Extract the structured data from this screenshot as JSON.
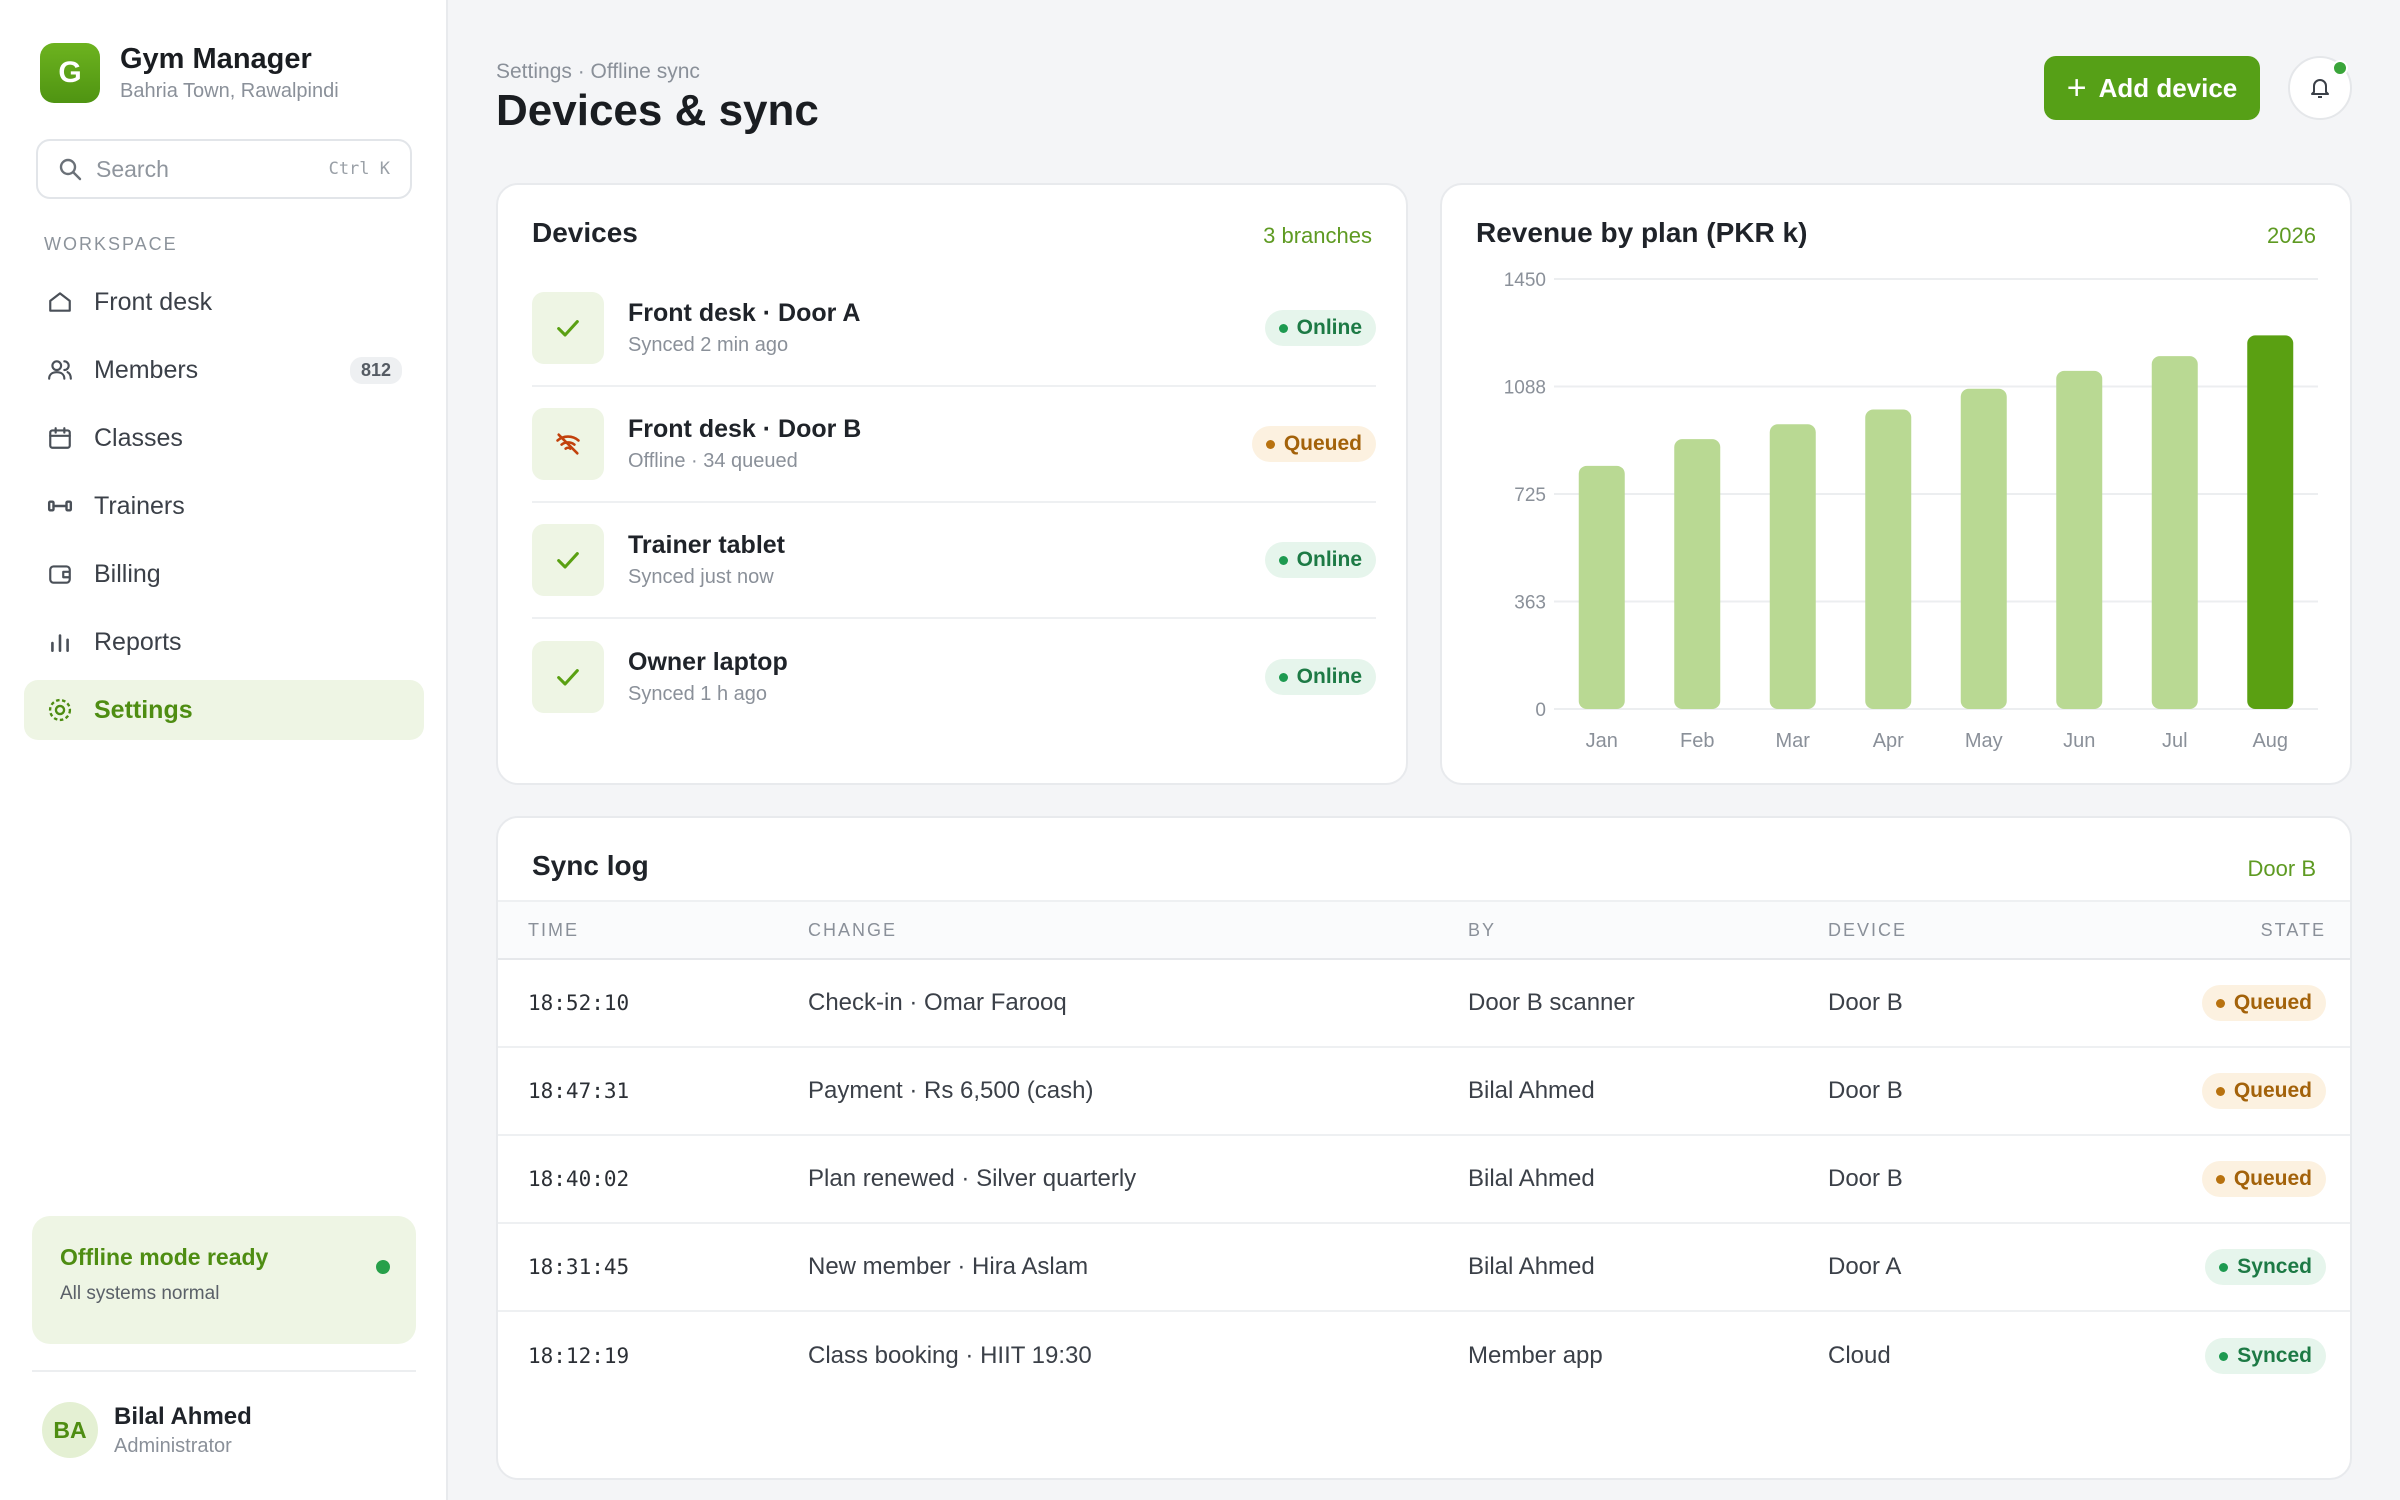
{
  "brand": {
    "initial": "G",
    "name": "Gym Manager",
    "location": "Bahria Town, Rawalpindi"
  },
  "search": {
    "placeholder": "Search",
    "shortcut": "Ctrl K"
  },
  "sidebar": {
    "section_label": "WORKSPACE",
    "items": [
      {
        "label": "Front desk",
        "icon": "home-icon"
      },
      {
        "label": "Members",
        "icon": "users-icon",
        "count": "812"
      },
      {
        "label": "Classes",
        "icon": "calendar-icon"
      },
      {
        "label": "Trainers",
        "icon": "dumbbell-icon"
      },
      {
        "label": "Billing",
        "icon": "wallet-icon"
      },
      {
        "label": "Reports",
        "icon": "bar-chart-icon"
      },
      {
        "label": "Settings",
        "icon": "gear-icon",
        "active": true
      }
    ],
    "offline": {
      "title": "Offline mode ready",
      "subtitle": "All systems normal"
    },
    "user": {
      "initials": "BA",
      "name": "Bilal Ahmed",
      "role": "Administrator"
    }
  },
  "header": {
    "breadcrumb": "Settings · Offline sync",
    "title": "Devices & sync",
    "add_label": "Add device"
  },
  "devices": {
    "title": "Devices",
    "meta": "3 branches",
    "items": [
      {
        "name": "Front desk · Door A",
        "sub": "Synced 2 min ago",
        "status": "Online",
        "state": "online",
        "icon": "check-icon"
      },
      {
        "name": "Front desk · Door B",
        "sub": "Offline · 34 queued",
        "status": "Queued",
        "state": "queued",
        "icon": "wifi-off-icon"
      },
      {
        "name": "Trainer tablet",
        "sub": "Synced just now",
        "status": "Online",
        "state": "online",
        "icon": "check-icon"
      },
      {
        "name": "Owner laptop",
        "sub": "Synced 1 h ago",
        "status": "Online",
        "state": "online",
        "icon": "check-icon"
      }
    ]
  },
  "chart_data": {
    "type": "bar",
    "title": "Revenue by plan (PKR k)",
    "meta": "2026",
    "categories": [
      "Jan",
      "Feb",
      "Mar",
      "Apr",
      "May",
      "Jun",
      "Jul",
      "Aug"
    ],
    "values": [
      820,
      910,
      960,
      1010,
      1080,
      1140,
      1190,
      1260
    ],
    "highlight_index": 7,
    "ylim": [
      0,
      1450
    ],
    "yticks": [
      "0",
      "363",
      "725",
      "1088",
      "1450"
    ],
    "colors": {
      "bar": "#b9d993",
      "highlight": "#5aa012",
      "grid": "#eceef0"
    }
  },
  "sync_log": {
    "title": "Sync log",
    "meta": "Door B",
    "columns": [
      "TIME",
      "CHANGE",
      "BY",
      "DEVICE",
      "STATE"
    ],
    "rows": [
      {
        "time": "18:52:10",
        "change": "Check-in · Omar Farooq",
        "by": "Door B scanner",
        "device": "Door B",
        "state": "Queued",
        "kind": "queued"
      },
      {
        "time": "18:47:31",
        "change": "Payment · Rs 6,500 (cash)",
        "by": "Bilal Ahmed",
        "device": "Door B",
        "state": "Queued",
        "kind": "queued"
      },
      {
        "time": "18:40:02",
        "change": "Plan renewed · Silver quarterly",
        "by": "Bilal Ahmed",
        "device": "Door B",
        "state": "Queued",
        "kind": "queued"
      },
      {
        "time": "18:31:45",
        "change": "New member · Hira Aslam",
        "by": "Bilal Ahmed",
        "device": "Door A",
        "state": "Synced",
        "kind": "synced"
      },
      {
        "time": "18:12:19",
        "change": "Class booking · HIIT 19:30",
        "by": "Member app",
        "device": "Cloud",
        "state": "Synced",
        "kind": "synced"
      }
    ]
  }
}
